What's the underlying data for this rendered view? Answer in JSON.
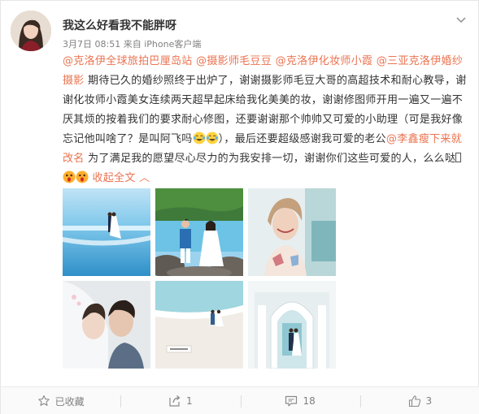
{
  "post": {
    "username": "我这么好看我不能胖呀",
    "timestamp": "3月7日 08:51",
    "source_prefix": "来自",
    "source": "iPhone客户端",
    "text": {
      "mention1": "@克洛伊全球旅拍巴厘岛站",
      "mention2": "@摄影师毛豆豆",
      "mention3": "@克洛伊化妆师小霞",
      "mention4": "@三亚克洛伊婚纱摄影",
      "part1": " 期待已久的婚纱照终于出炉了，谢谢摄影师毛豆大哥的高超技术和耐心教导，谢谢化妆师小霞美女连续两天超早起床给我化美美的妆，谢谢修图师开用一遍又一遍不厌其烦的按着我们的要求耐心修图，还要谢谢那个帅帅又可爱的小助理（可是我好像忘记他叫啥了？是叫阿飞吗",
      "part2": "），最后还要超级感谢我可爱的老公",
      "mention5": "@李鑫瘦下来就改名",
      "part3": " 为了满足我的愿望尽心尽力的为我安排一切，谢谢你们这些可爱的人，么么哒",
      "collapse": "收起全文 ︿"
    },
    "emojis": [
      "laugh-cry-icon",
      "laugh-cry-icon",
      "shocked-icon",
      "shocked-icon"
    ],
    "photos": [
      "beach-couple-photo",
      "rock-shore-couple-photo",
      "bride-portrait-photo",
      "veil-couple-photo",
      "sand-beach-photo",
      "white-chapel-photo"
    ]
  },
  "actions": {
    "favorite": {
      "icon": "star-icon",
      "label": "已收藏"
    },
    "repost": {
      "icon": "repost-icon",
      "count": "1"
    },
    "comment": {
      "icon": "comment-icon",
      "count": "18"
    },
    "like": {
      "icon": "thumbs-up-icon",
      "count": "3"
    }
  },
  "colors": {
    "link": "#eb7350",
    "text": "#333333",
    "meta": "#808080"
  }
}
